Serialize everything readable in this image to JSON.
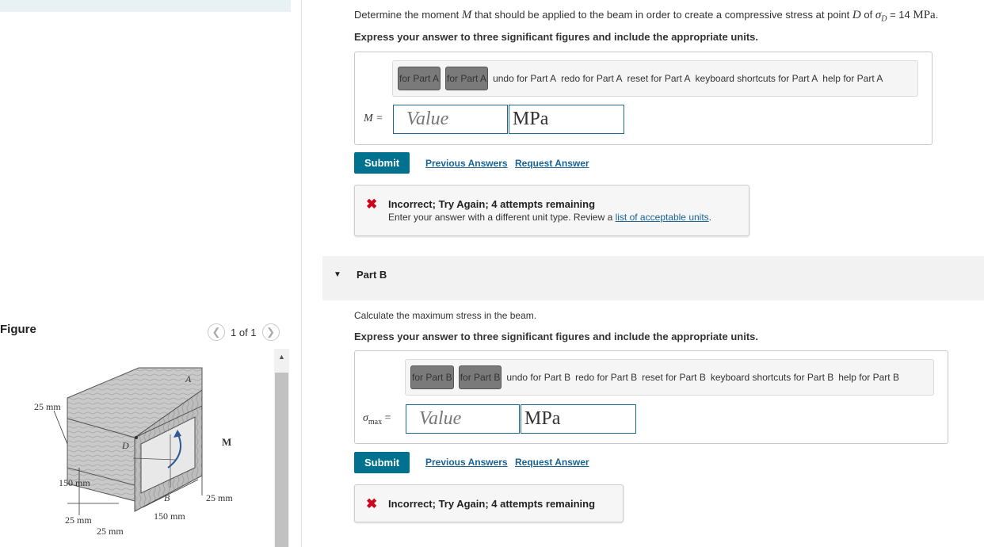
{
  "figure": {
    "title": "Figure",
    "pager": "1 of 1",
    "prev_icon": "chevron-left-icon",
    "next_icon": "chevron-right-icon",
    "labels": {
      "A": "A",
      "B": "B",
      "D": "D",
      "M": "M",
      "dim_25_top": "25 mm",
      "dim_150_left": "150 mm",
      "dim_25_bottom_left": "25 mm",
      "dim_25_bottom": "25 mm",
      "dim_150_bottom": "150 mm",
      "dim_25_right": "25 mm"
    }
  },
  "partA": {
    "question_pre": "Determine the moment ",
    "question_var": "M",
    "question_mid": " that should be applied to the beam in order to create a compressive stress at point ",
    "question_point": "D",
    "question_of": " of ",
    "question_sigma": "σ",
    "question_sub": "D",
    "question_value": " = 14 ",
    "question_unit": "MPa",
    "instruction": "Express your answer to three significant figures and include the appropriate units.",
    "toolbar": {
      "btn1": "for Part A",
      "btn2": "for Part A",
      "undo": "undo for Part A",
      "redo": "redo for Part A",
      "reset": "reset for Part A",
      "keyboard": "keyboard shortcuts for Part A",
      "help": "help for Part A"
    },
    "var_label": "M =",
    "value_placeholder": "Value",
    "unit_value": "MPa",
    "submit": "Submit",
    "previous_answers": "Previous Answers",
    "request_answer": "Request Answer",
    "feedback_title": "Incorrect; Try Again; 4 attempts remaining",
    "feedback_body_pre": "Enter your answer with a different unit type. Review a ",
    "feedback_link": "list of acceptable units",
    "feedback_body_post": "."
  },
  "partB": {
    "header": "Part B",
    "question": "Calculate the maximum stress in the beam.",
    "instruction": "Express your answer to three significant figures and include the appropriate units.",
    "toolbar": {
      "btn1": "for Part B",
      "btn2": "for Part B",
      "undo": "undo for Part B",
      "redo": "redo for Part B",
      "reset": "reset for Part B",
      "keyboard": "keyboard shortcuts for Part B",
      "help": "help for Part B"
    },
    "var_sigma": "σ",
    "var_sub": "max",
    "var_eq": "=",
    "value_placeholder": "Value",
    "unit_value": "MPa",
    "submit": "Submit",
    "previous_answers": "Previous Answers",
    "request_answer": "Request Answer",
    "feedback_title": "Incorrect; Try Again; 4 attempts remaining"
  },
  "colors": {
    "submit": "#00728f",
    "link": "#1a6496",
    "error": "#d0021b",
    "input_border": "#1b6a8f"
  }
}
